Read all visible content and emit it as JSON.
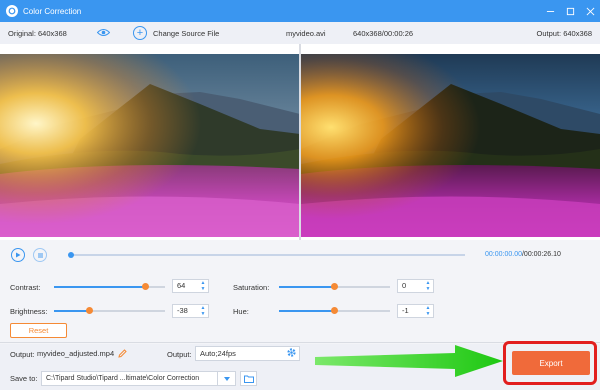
{
  "window": {
    "title": "Color Correction"
  },
  "infobar": {
    "original": "Original: 640x368",
    "change_source": "Change Source File",
    "filename": "myvideo.avi",
    "file_info": "640x368/00:00:26",
    "output": "Output: 640x368"
  },
  "playback": {
    "current_time": "00:00:00.00",
    "total_time": "/00:00:26.10",
    "progress": 0
  },
  "adjust": {
    "contrast": {
      "label": "Contrast:",
      "value": "64",
      "level": 0.82
    },
    "saturation": {
      "label": "Saturation:",
      "value": "0",
      "level": 0.5
    },
    "brightness": {
      "label": "Brightness:",
      "value": "-38",
      "level": 0.32
    },
    "hue": {
      "label": "Hue:",
      "value": "-1",
      "level": 0.5
    },
    "reset_label": "Reset"
  },
  "output": {
    "label": "Output:",
    "filename": "myvideo_adjusted.mp4",
    "format_label": "Output:",
    "format_value": "Auto;24fps"
  },
  "save": {
    "label": "Save to:",
    "path": "C:\\Tipard Studio\\Tipard ...ltimate\\Color Correction"
  },
  "export_label": "Export",
  "colors": {
    "accent": "#3a96f0",
    "orange": "#f58a35",
    "export": "#f06a3a",
    "highlight": "#e21e1e",
    "arrow": "#34d11e"
  }
}
